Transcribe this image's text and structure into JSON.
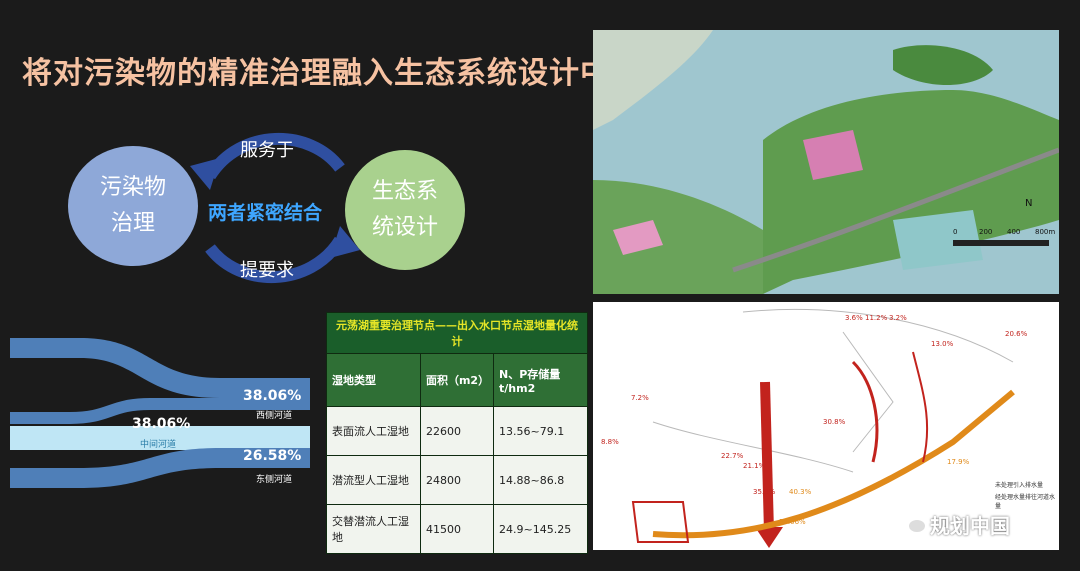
{
  "title": "将对污染物的精准治理融入生态系统设计中",
  "concept": {
    "left_circle": [
      "污染物",
      "治理"
    ],
    "right_circle": [
      "生态系",
      "统设计"
    ],
    "top_arrow_label": "服务于",
    "bottom_arrow_label": "提要求",
    "center_text": "两者紧密结合",
    "colors": {
      "left": "#8ea8d8",
      "right": "#a9d18e",
      "arrow": "#2f4fa0",
      "center_text": "#3ea6ff"
    }
  },
  "flow": {
    "top_pct": "38.06%",
    "top_label": "西侧河道",
    "middle_pct": "38.06%",
    "middle_label": "中间河道",
    "bottom_pct": "26.58%",
    "bottom_label": "东侧河道"
  },
  "table": {
    "caption": "元荡湖重要治理节点——出入水口节点湿地量化统计",
    "headers": [
      "湿地类型",
      "面积（m2）",
      "N、P存储量t/hm2"
    ],
    "rows": [
      [
        "表面流人工湿地",
        "22600",
        "13.56~79.1"
      ],
      [
        "潜流型人工湿地",
        "24800",
        "14.88~86.8"
      ],
      [
        "交替潜流人工湿地",
        "41500",
        "24.9~145.25"
      ]
    ]
  },
  "map1": {
    "scale_ticks": [
      "0",
      "200",
      "400",
      "800m"
    ],
    "north_label": "N"
  },
  "map2": {
    "flow_labels": [
      "3.6%",
      "11.2%",
      "3.2%",
      "20.6%",
      "13.0%",
      "7.2%",
      "8.8%",
      "22.7%",
      "21.1%",
      "30.8%",
      "35.3%",
      "40.3%",
      "38.06%",
      "17.9%"
    ],
    "legend": [
      "未处理引入排水量",
      "经处理水量排往河道水量"
    ]
  },
  "watermark": "规划中国"
}
